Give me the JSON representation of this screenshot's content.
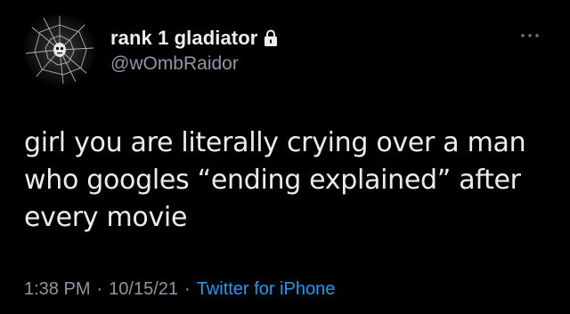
{
  "user": {
    "display_name": "rank 1 gladiator",
    "handle": "@wOmbRaidor",
    "avatar_icon": "broken-glass-avatar-icon",
    "locked_icon": "lock-icon"
  },
  "menu": {
    "more_icon": "more-options-icon"
  },
  "tweet": {
    "text": "girl you are literally crying over a man\nwho googles “ending explained” after\nevery movie"
  },
  "meta": {
    "time": "1:38 PM",
    "separator": "·",
    "date": "10/15/21",
    "source": "Twitter for iPhone"
  },
  "colors": {
    "background": "#000000",
    "text": "#e7e9ea",
    "secondary": "#8b98a5",
    "link": "#1d9bf0"
  }
}
